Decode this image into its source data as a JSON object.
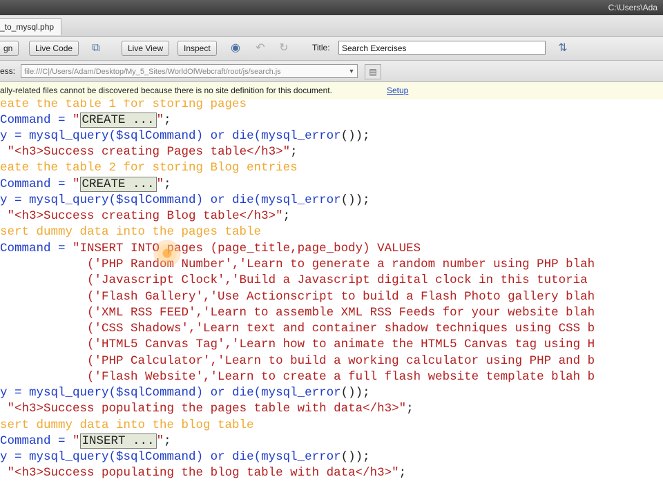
{
  "window": {
    "path": "C:\\Users\\Ada"
  },
  "tab": {
    "label": "_to_mysql.php"
  },
  "toolbar": {
    "design_label": "gn",
    "live_code_label": "Live Code",
    "live_view_label": "Live View",
    "inspect_label": "Inspect",
    "title_label": "Title:",
    "title_value": "Search Exercises"
  },
  "address": {
    "label": "ess:",
    "value": "file:///C|/Users/Adam/Desktop/My_5_Sites/WorldOfWebcraft/root/js/search.js"
  },
  "infobar": {
    "message": "ally-related files cannot be discovered because there is no site definition for this document.",
    "link": "Setup"
  },
  "code": {
    "l1": "eate the table 1 for storing pages",
    "l2a": "Command = ",
    "l2b": "CREATE ...",
    "l3a": "y = mysql_query(",
    "l3b": "$sqlCommand",
    "l3c": ") or die(",
    "l3d": "mysql_error",
    "l3e": "());",
    "l4a": " ",
    "l4b": "\"<h3>Success creating Pages table</h3>\"",
    "l4c": ";",
    "l5": "eate the table 2 for storing Blog entries",
    "l6a": "Command = ",
    "l6b": "CREATE ...",
    "l7a": "y = mysql_query(",
    "l7b": "$sqlCommand",
    "l7c": ") or die(",
    "l7d": "mysql_error",
    "l7e": "());",
    "l8a": " ",
    "l8b": "\"<h3>Success creating Blog table</h3>\"",
    "l8c": ";",
    "l9": "sert dummy data into the pages table",
    "l10a": "Command = ",
    "l10b": "\"INSERT INTO pages (page_title,page_body) VALUES",
    "l11": "            ('PHP Random Number','Learn to generate a random number using PHP blah",
    "l12": "            ('Javascript Clock','Build a Javascript digital clock in this tutoria",
    "l13": "            ('Flash Gallery','Use Actionscript to build a Flash Photo gallery blah",
    "l14": "            ('XML RSS FEED','Learn to assemble XML RSS Feeds for your website blah",
    "l15": "            ('CSS Shadows','Learn text and container shadow techniques using CSS b",
    "l16": "            ('HTML5 Canvas Tag','Learn how to animate the HTML5 Canvas tag using H",
    "l17": "            ('PHP Calculator','Learn to build a working calculator using PHP and b",
    "l18": "            ('Flash Website','Learn to create a full flash website template blah b",
    "l19a": "y = mysql_query(",
    "l19b": "$sqlCommand",
    "l19c": ") or die(",
    "l19d": "mysql_error",
    "l19e": "());",
    "l20a": " ",
    "l20b": "\"<h3>Success populating the pages table with data</h3>\"",
    "l20c": ";",
    "l21": "sert dummy data into the blog table",
    "l22a": "Command = ",
    "l22b": "INSERT ...",
    "l23a": "y = mysql_query(",
    "l23b": "$sqlCommand",
    "l23c": ") or die(",
    "l23d": "mysql_error",
    "l23e": "());",
    "l24a": " ",
    "l24b": "\"<h3>Success populating the blog table with data</h3>\"",
    "l24c": ";"
  },
  "colors": {
    "comment": "#f0a830",
    "variable": "#1e3cc8",
    "string": "#b52020"
  }
}
